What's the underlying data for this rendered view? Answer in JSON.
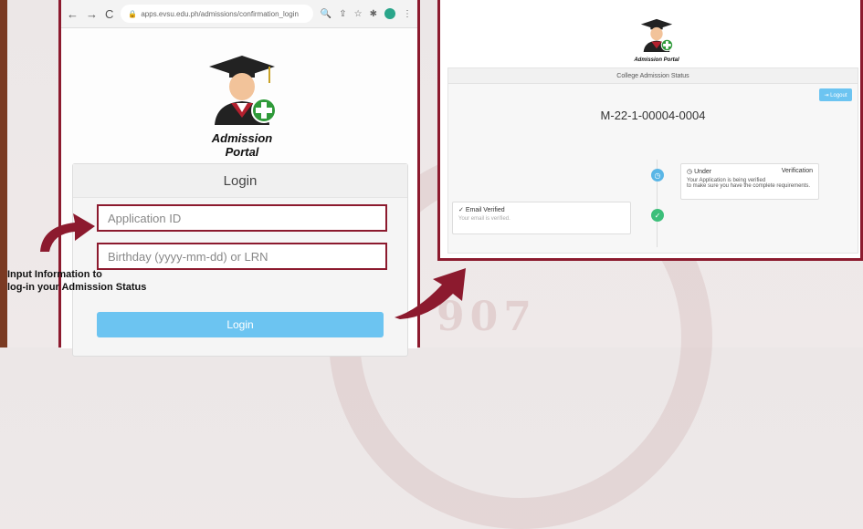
{
  "browser": {
    "url": "apps.evsu.edu.ph/admissions/confirmation_login",
    "nav": {
      "back": "←",
      "forward": "→",
      "reload": "C"
    }
  },
  "login_page": {
    "portal_title": "Admission Portal",
    "card_title": "Login",
    "application_id_placeholder": "Application ID",
    "birthday_placeholder": "Birthday (yyyy-mm-dd) or LRN",
    "login_button": "Login"
  },
  "annotation": {
    "line1": "Input Information to",
    "line2": "log-in your Admission Status"
  },
  "status_page": {
    "portal_title": "Admission Portal",
    "header": "College Admission Status",
    "logout_button": "⇥ Logout",
    "application_number": "M-22-1-00004-0004",
    "under": {
      "title_left": "Under",
      "title_right": "Verification",
      "desc1": "Your Application is being verified",
      "desc2": "to make sure you have the complete requirements."
    },
    "email": {
      "title": "Email Verified",
      "desc": "Your email is verified."
    }
  },
  "watermark": "907",
  "colors": {
    "accent_border": "#8c1a2e",
    "button": "#6cc4f1",
    "verified": "#3cbf7a",
    "pending": "#5ab6e6"
  }
}
